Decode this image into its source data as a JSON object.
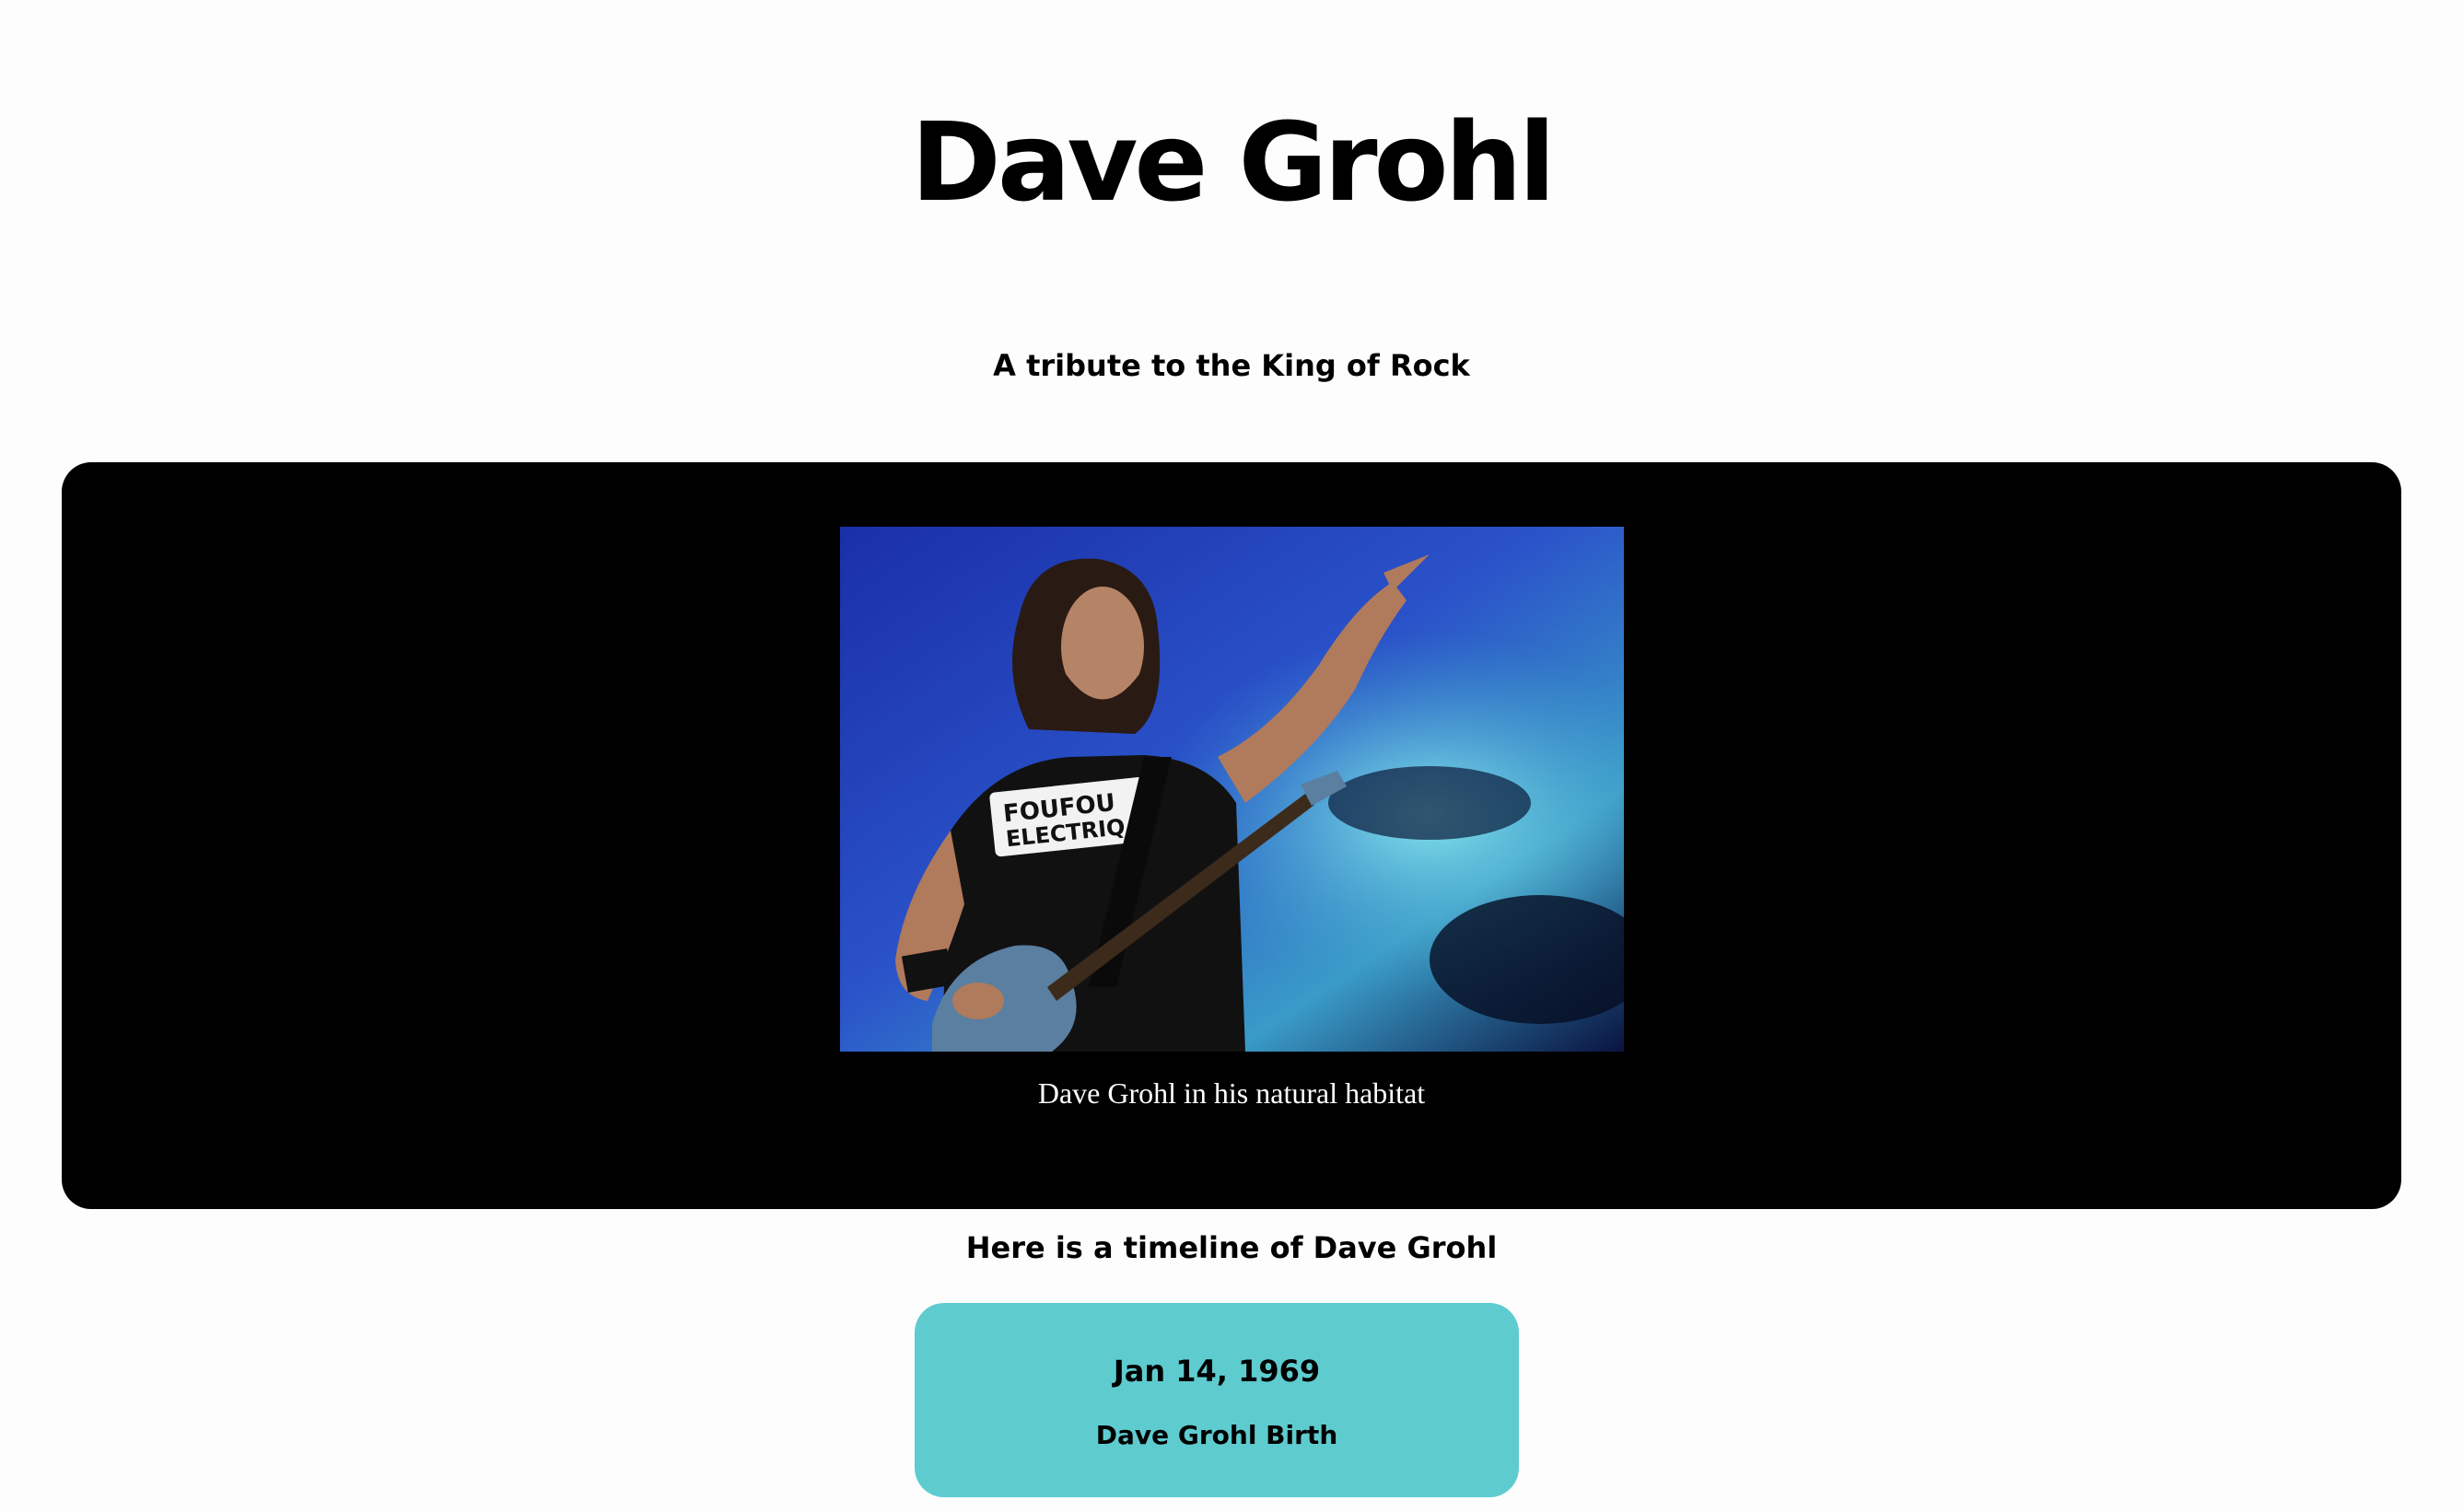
{
  "header": {
    "title": "Dave Grohl",
    "subtitle": "A tribute to the King of Rock"
  },
  "hero": {
    "caption": "Dave Grohl in his natural habitat",
    "photo_shirt_text": [
      "FOUFOU",
      "ELECTRIQ"
    ]
  },
  "timeline": {
    "heading": "Here is a timeline of Dave Grohl",
    "items": [
      {
        "date": "Jan 14, 1969",
        "event": "Dave Grohl Birth"
      }
    ]
  },
  "colors": {
    "page_background": "#fdfdfd",
    "hero_background": "#000000",
    "card_background": "#5ecbcf",
    "text": "#000000",
    "caption_text": "#ffffff"
  }
}
